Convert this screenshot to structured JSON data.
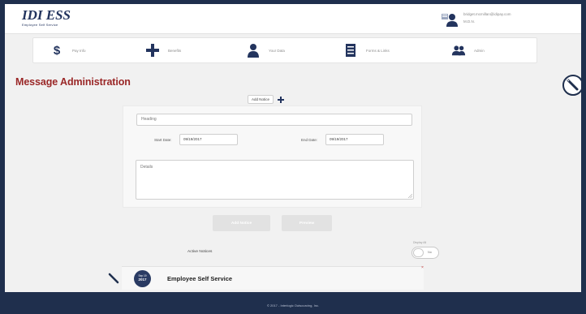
{
  "header": {
    "logo_text": "IDI ESS",
    "logo_subtitle": "Employee Self Service",
    "user_email": "bridget.mcmillan@idipay.com",
    "user_name": "M.D.N."
  },
  "nav": {
    "items": [
      {
        "label": "Pay Info",
        "icon": "dollar-icon"
      },
      {
        "label": "Benefits",
        "icon": "plus-icon"
      },
      {
        "label": "Your Data",
        "icon": "person-icon"
      },
      {
        "label": "Forms & Links",
        "icon": "forms-icon"
      },
      {
        "label": "Admin",
        "icon": "group-icon"
      }
    ]
  },
  "page": {
    "title": "Message Administration",
    "add_notice_label": "Add Notice"
  },
  "form": {
    "heading_value": "Heading",
    "start_date_label": "Start Date:",
    "start_date_value": "09/19/2017",
    "end_date_label": "End Date:",
    "end_date_value": "09/19/2017",
    "details_value": "Details",
    "add_button_label": "Add Notice",
    "preview_button_label": "Preview"
  },
  "notices": {
    "active_label": "Active Notices",
    "display_all_label": "Display All",
    "toggle_text": "No",
    "card": {
      "badge_month": "Sep 19",
      "badge_year": "2017",
      "title": "Employee Self Service",
      "close_symbol": "×"
    }
  },
  "footer": {
    "text": "© 2017 - Interlogic Outsourcing, Inc."
  },
  "colors": {
    "brand_navy": "#1f2f4d",
    "title_red": "#9a2727",
    "page_bg": "#f1f1f1"
  }
}
